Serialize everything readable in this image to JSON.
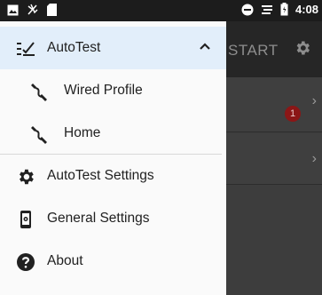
{
  "status_bar": {
    "time": "4:08",
    "left_icons": [
      "image-icon",
      "no-signal-icon",
      "sd-card-icon"
    ],
    "right_icons": [
      "do-not-disturb-icon",
      "network-icon",
      "battery-icon"
    ]
  },
  "background": {
    "toolbar_action": "START",
    "badge_count": "1"
  },
  "drawer": {
    "items": [
      {
        "label": "AutoTest",
        "icon": "autotest-icon",
        "expanded": true
      },
      {
        "label": "Wired Profile",
        "icon": "ethernet-cable-icon"
      },
      {
        "label": "Home",
        "icon": "ethernet-cable-icon"
      },
      {
        "label": "AutoTest Settings",
        "icon": "gear-icon"
      },
      {
        "label": "General Settings",
        "icon": "phone-settings-icon"
      },
      {
        "label": "About",
        "icon": "help-icon"
      }
    ]
  },
  "colors": {
    "active_item_bg": "#e2eefa",
    "drawer_bg": "#fafafa",
    "badge": "#8b1616"
  }
}
